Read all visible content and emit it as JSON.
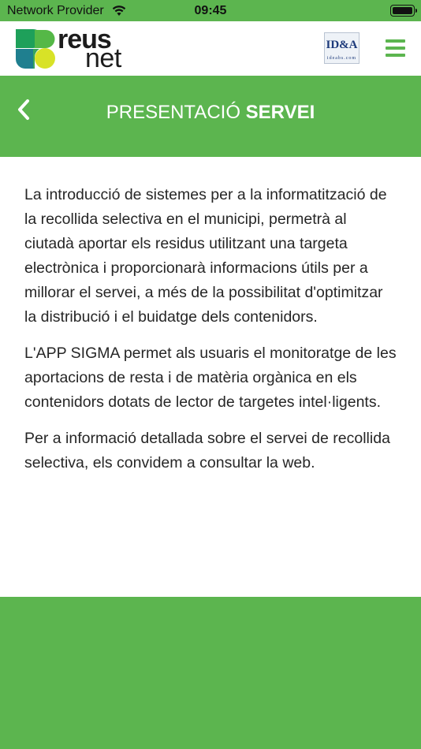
{
  "status_bar": {
    "carrier": "Network Provider",
    "time": "09:45",
    "wifi_icon": "wifi-icon",
    "battery_icon": "battery-icon"
  },
  "header": {
    "logo": {
      "word_top": "reus",
      "word_bottom": "net",
      "colors": [
        "#1ea05a",
        "#55b847",
        "#d8e227",
        "#1f7f8f"
      ]
    },
    "partner_logo": {
      "text": "ID&A",
      "subtext": "ideabs.com"
    },
    "menu_icon": "hamburger-menu-icon"
  },
  "title_bar": {
    "back_icon": "chevron-left-icon",
    "title_part1": "PRESENTACIÓ",
    "title_part2": "SERVEI"
  },
  "content": {
    "paragraphs": [
      "La introducció de sistemes per a la informatització de la recollida selectiva en el municipi, permetrà al ciutadà aportar els residus utilitzant una targeta electrònica i proporcionarà informacions útils per a millorar el servei, a més de la possibilitat d'optimitzar la distribució i el buidatge dels contenidors.",
      "L'APP SIGMA permet als usuaris el monitoratge de les aportacions de resta i de matèria orgànica en els contenidors dotats de lector de targetes intel·ligents.",
      "Per a informació detallada sobre el servei de recollida selectiva, els convidem a consultar la web."
    ]
  },
  "colors": {
    "brand_green": "#5cb54f",
    "text": "#262626",
    "background": "#ffffff"
  }
}
